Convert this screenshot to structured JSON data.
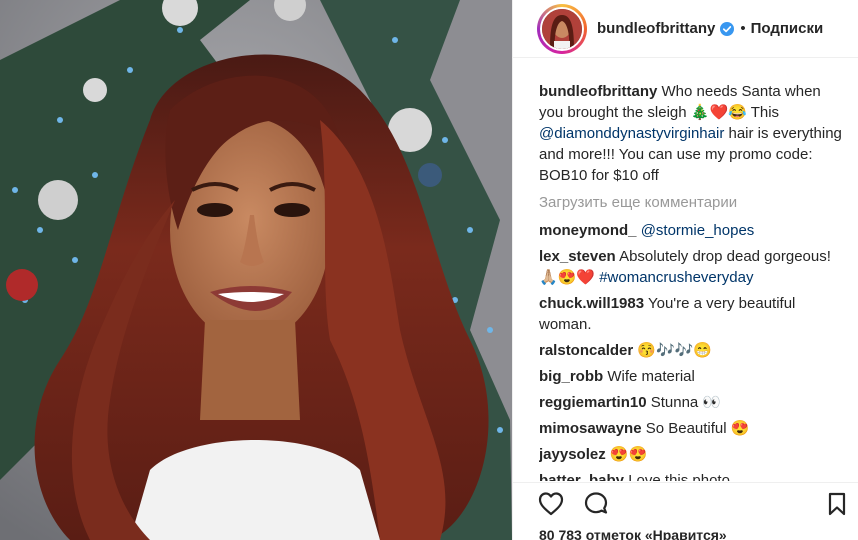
{
  "post": {
    "username": "bundleofbrittany",
    "follow_label": "Подписки",
    "separator": "•"
  },
  "caption": {
    "username": "bundleofbrittany",
    "text_1": "Who needs Santa when you brought the sleigh 🎄❤️😂 This",
    "mention": "@diamonddynastyvirginhair",
    "text_2": "hair is everything and more!!! You can use my promo code: BOB10 for $10 off"
  },
  "load_more_label": "Загрузить еще комментарии",
  "comments": [
    {
      "user": "moneymond_",
      "mention": "@stormie_hopes",
      "text": "",
      "hashtag": ""
    },
    {
      "user": "lex_steven",
      "mention": "",
      "text": "Absolutely drop dead gorgeous!🙏🏼😍❤️",
      "hashtag": "#womancrusheveryday"
    },
    {
      "user": "chuck.will1983",
      "mention": "",
      "text": "You're a very beautiful woman.",
      "hashtag": ""
    },
    {
      "user": "ralstoncalder",
      "mention": "",
      "text": "😚🎶🎶😁",
      "hashtag": ""
    },
    {
      "user": "big_robb",
      "mention": "",
      "text": "Wife material",
      "hashtag": ""
    },
    {
      "user": "reggiemartin10",
      "mention": "",
      "text": "Stunna 👀",
      "hashtag": ""
    },
    {
      "user": "mimosawayne",
      "mention": "",
      "text": "So Beautiful 😍",
      "hashtag": ""
    },
    {
      "user": "jayysolez",
      "mention": "",
      "text": "😍😍",
      "hashtag": ""
    },
    {
      "user": "batter_baby",
      "mention": "",
      "text": "Love this photo",
      "hashtag": ""
    }
  ],
  "likes_text": "80 783 отметок «Нравится»",
  "icons": {
    "like": "heart-outline-icon",
    "comment": "comment-bubble-icon",
    "save": "bookmark-outline-icon",
    "verified": "verified-badge-icon"
  },
  "colors": {
    "link": "#003569",
    "verified": "#3897f0",
    "muted": "#999999",
    "text": "#262626"
  }
}
